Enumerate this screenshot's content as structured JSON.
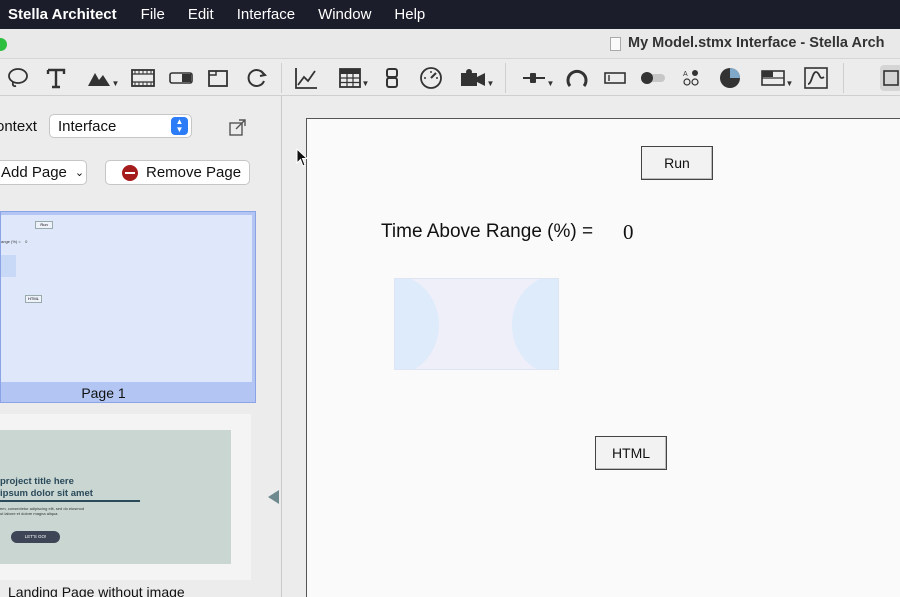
{
  "menubar": {
    "app": "Stella Architect",
    "items": [
      "File",
      "Edit",
      "Interface",
      "Window",
      "Help"
    ]
  },
  "window": {
    "title": "My Model.stmx Interface - Stella Arch"
  },
  "toolbar": {
    "tools": [
      "lasso-tool-icon",
      "text-tool-icon",
      "image-tool-icon",
      "video-tool-icon",
      "button-tool-icon",
      "container-tool-icon",
      "loop-tool-icon",
      "graph-tool-icon",
      "table-tool-icon",
      "numeric-display-icon",
      "gauge-icon",
      "sketchable-time-icon",
      "slider-tool-icon",
      "knob-tool-icon",
      "input-box-icon",
      "switch-tool-icon",
      "option-group-icon",
      "pie-input-icon",
      "list-input-icon",
      "graphical-input-icon"
    ]
  },
  "panel": {
    "context_label": "ontext",
    "context_value": "Interface",
    "add_page_label": "Add Page",
    "remove_page_label": "Remove Page",
    "pages": [
      {
        "label": "Page 1",
        "selected": true
      },
      {
        "label": "Landing Page without image",
        "selected": false
      }
    ],
    "mini": {
      "run": "Run",
      "text": "ange (%) =",
      "value": "0",
      "html": "HTML"
    },
    "landing": {
      "heading1": "project title here",
      "heading2": "ipsum dolor sit amet",
      "body1": "em, consectetur adipiscing elit, sed do eiusmod",
      "body2": "ut labore et dolore magna aliqua.",
      "cta": "LET'S GO!"
    }
  },
  "canvas": {
    "run_label": "Run",
    "metric_label": "Time Above Range (%) =",
    "metric_value": "0",
    "html_label": "HTML"
  },
  "colors": {
    "menubar": "#1b1d2a",
    "selected_page": "#b3c6f3",
    "stepper": "#2b7cf6",
    "remove": "#a51c1c"
  }
}
